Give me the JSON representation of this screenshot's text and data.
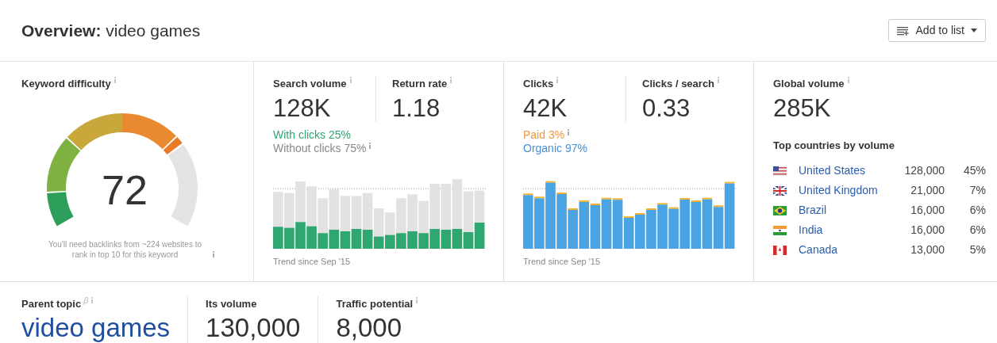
{
  "header": {
    "title_bold": "Overview:",
    "title_rest": "video games",
    "add_button": "Add to list"
  },
  "difficulty": {
    "label": "Keyword difficulty",
    "value": "72",
    "note": "You'll need backlinks from ~224 websites to rank in top 10 for this keyword"
  },
  "search": {
    "volume_label": "Search volume",
    "volume": "128K",
    "return_label": "Return rate",
    "return_value": "1.18",
    "with_clicks": "With clicks 25%",
    "without_clicks": "Without clicks 75%",
    "trend": "Trend since Sep '15"
  },
  "clicks": {
    "clicks_label": "Clicks",
    "clicks": "42K",
    "per_search_label": "Clicks / search",
    "per_search": "0.33",
    "paid": "Paid 3%",
    "organic": "Organic 97%",
    "trend": "Trend since Sep '15"
  },
  "global": {
    "label": "Global volume",
    "value": "285K",
    "countries_title": "Top countries by volume",
    "countries": [
      {
        "kind": "us",
        "name": "United States",
        "volume": "128,000",
        "share": "45%"
      },
      {
        "kind": "uk",
        "name": "United Kingdom",
        "volume": "21,000",
        "share": "7%"
      },
      {
        "kind": "br",
        "name": "Brazil",
        "volume": "16,000",
        "share": "6%"
      },
      {
        "kind": "in",
        "name": "India",
        "volume": "16,000",
        "share": "6%"
      },
      {
        "kind": "ca",
        "name": "Canada",
        "volume": "13,000",
        "share": "5%"
      }
    ]
  },
  "bottom": {
    "parent_label": "Parent topic",
    "beta": "β",
    "parent_value": "video games",
    "its_volume_label": "Its volume",
    "its_volume": "130,000",
    "traffic_label": "Traffic potential",
    "traffic": "8,000"
  }
}
